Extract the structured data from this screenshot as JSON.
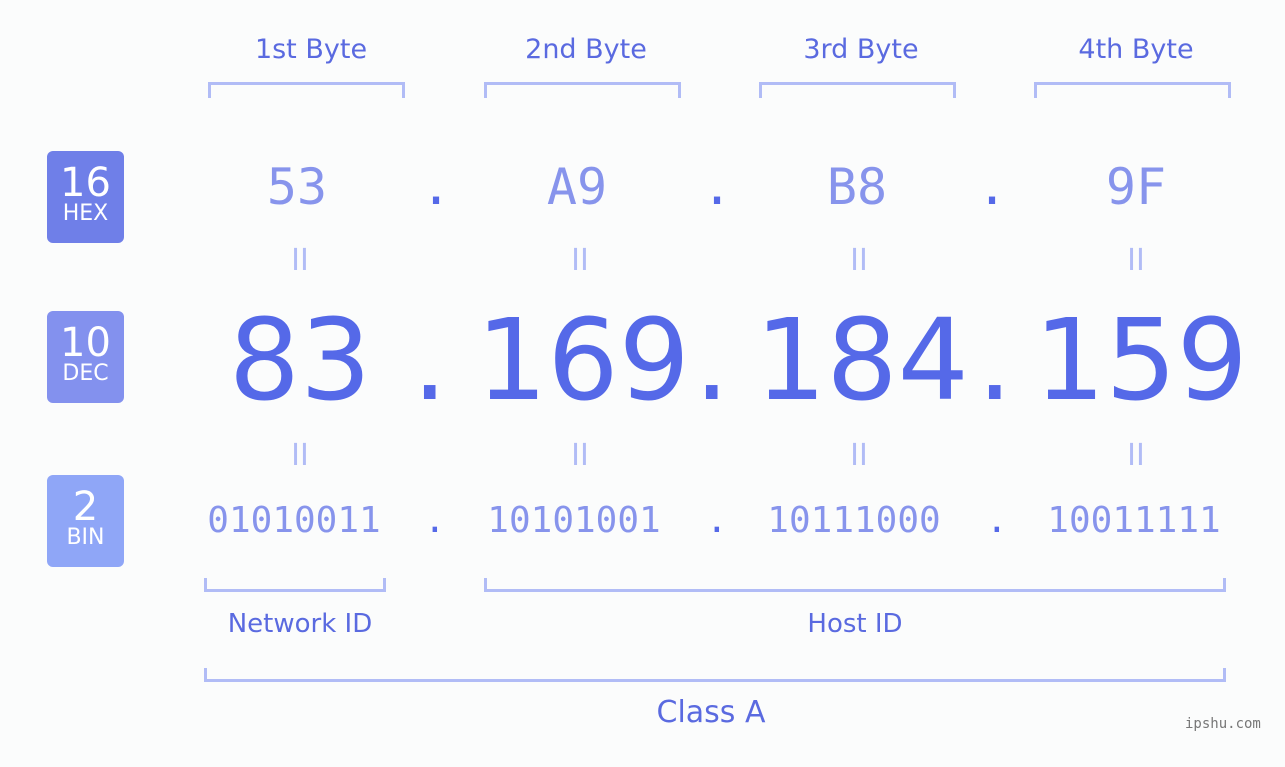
{
  "bytes": [
    {
      "label": "1st Byte",
      "hex": "53",
      "dec": "83",
      "bin": "01010011"
    },
    {
      "label": "2nd Byte",
      "hex": "A9",
      "dec": "169",
      "bin": "10101001"
    },
    {
      "label": "3rd Byte",
      "hex": "B8",
      "dec": "184",
      "bin": "10111000"
    },
    {
      "label": "4th Byte",
      "hex": "9F",
      "dec": "159",
      "bin": "10011111"
    }
  ],
  "separator": ".",
  "equals": "II",
  "badges": {
    "hex": {
      "base": "16",
      "name": "HEX",
      "color": "#6f7fe8"
    },
    "dec": {
      "base": "10",
      "name": "DEC",
      "color": "#8391ee"
    },
    "bin": {
      "base": "2",
      "name": "BIN",
      "color": "#8fa6f7"
    }
  },
  "network_id_label": "Network ID",
  "host_id_label": "Host ID",
  "class_label": "Class A",
  "watermark": "ipshu.com"
}
